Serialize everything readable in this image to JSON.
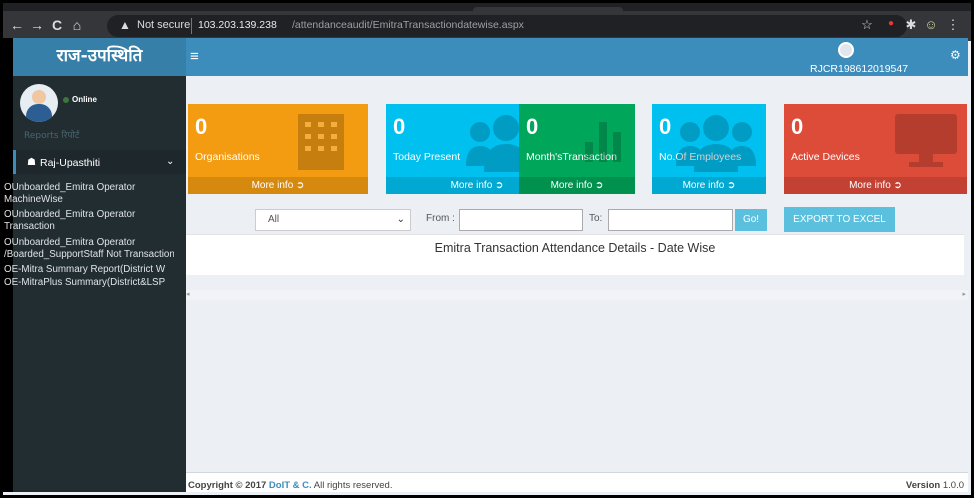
{
  "browser": {
    "warning_glyph": "▲",
    "not_secure": "Not secure",
    "url_host": "103.203.139.238",
    "url_path": "/attendanceaudit/EmitraTransactiondatewise.aspx",
    "back_glyph": "←",
    "forward_glyph": "→",
    "reload_glyph": "C",
    "home_glyph": "⌂",
    "star_glyph": "☆",
    "puzzle_glyph": "✱",
    "menu_glyph": "⋮"
  },
  "header": {
    "brand": "राज-उपस्थिति",
    "hamburger": "≡",
    "username": "RJCR198612019547",
    "settings_glyph": "⚙"
  },
  "sidebar": {
    "status": "Online",
    "reports_label": "Reports रिपोर्ट",
    "menu_head": {
      "icon": "☗",
      "label": "Raj-Upasthiti",
      "chevron": "⌄"
    },
    "items": [
      "OUnboarded_Emitra Operator",
      "MachineWise",
      "OUnboarded_Emitra Operator",
      "Transaction",
      "OUnboarded_Emitra Operator",
      "/Boarded_SupportStaff Not Transaction",
      "OE-Mitra Summary Report(District W",
      "OE-MitraPlus Summary(District&LSP"
    ]
  },
  "stats": [
    {
      "value": "0",
      "label": "Organisations",
      "more": "More info ➲",
      "color": "#f39c12"
    },
    {
      "value": "0",
      "label": "Today Present",
      "more": "More info ➲",
      "color": "#00c0ef"
    },
    {
      "value": "0",
      "label": "Month'sTransaction",
      "more": "More info ➲",
      "color": "#00a65a"
    },
    {
      "value": "0",
      "label": "No.Of Employees",
      "more": "More info ➲",
      "color": "#00c0ef"
    },
    {
      "value": "0",
      "label": "Active Devices",
      "more": "More info ➲",
      "color": "#dd4b39"
    }
  ],
  "filter": {
    "select_value": "All",
    "select_chevron": "⌄",
    "from_label": "From :",
    "to_label": "To:",
    "go_label": "Go!",
    "export_label": "EXPORT TO EXCEL"
  },
  "report": {
    "title": "Emitra Transaction Attendance Details - Date Wise"
  },
  "footer": {
    "copyright_prefix": "Copyright © 2017 ",
    "org": "DoIT & C.",
    "rights": " All rights reserved.",
    "version_label": "Version",
    "version": "1.0.0"
  }
}
